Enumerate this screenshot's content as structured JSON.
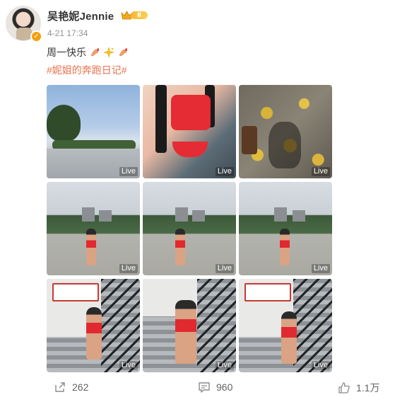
{
  "post": {
    "user_name": "吴艳妮Jennie",
    "vip_level": "Ⅱ",
    "time": "4-21 17:34",
    "text": "周一快乐",
    "emojis": [
      "arm-icon",
      "sparkle-icon",
      "arm-icon"
    ],
    "hashtag": "#妮姐的奔跑日记#"
  },
  "photos": [
    {
      "live": "Live",
      "scene": "sky"
    },
    {
      "live": "Live",
      "scene": "selfie"
    },
    {
      "live": "Live",
      "scene": "leaves"
    },
    {
      "live": "Live",
      "scene": "plaza"
    },
    {
      "live": "Live",
      "scene": "plaza"
    },
    {
      "live": "Live",
      "scene": "plaza"
    },
    {
      "live": "Live",
      "scene": "stairs"
    },
    {
      "live": "Live",
      "scene": "stairs"
    },
    {
      "live": "Live",
      "scene": "stairs"
    }
  ],
  "actions": {
    "repost": {
      "icon": "share-icon",
      "count": "262"
    },
    "comment": {
      "icon": "comment-icon",
      "count": "960"
    },
    "like": {
      "icon": "thumbs-up-icon",
      "count": "1.1万"
    }
  },
  "colors": {
    "hashtag": "#eb7350",
    "verify": "#f59f0a",
    "muted": "#939393"
  }
}
